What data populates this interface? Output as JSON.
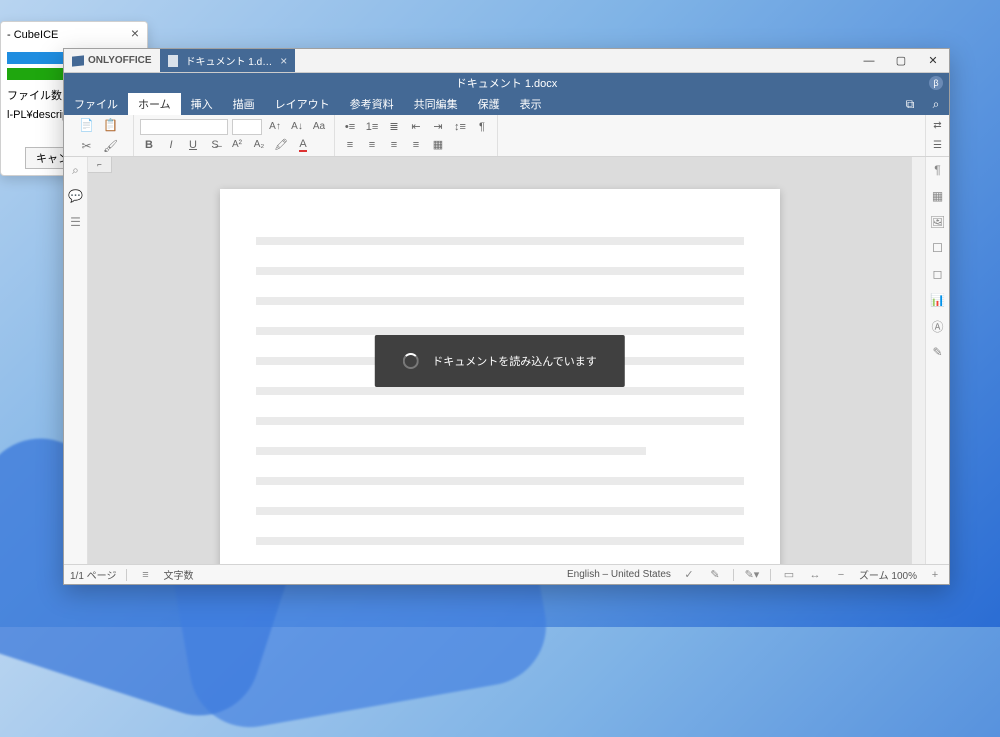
{
  "cubeice": {
    "title": " - CubeICE",
    "label1": "ファイル数",
    "label2": "l-PL¥description",
    "cancel": "キャン"
  },
  "onlyoffice": {
    "app_name": "ONLYOFFICE",
    "doctab_label": "ドキュメント 1.d…",
    "title": "ドキュメント 1.docx",
    "user_initial": "β",
    "menu": {
      "file": "ファイル",
      "home": "ホーム",
      "insert": "挿入",
      "draw": "描画",
      "layout": "レイアウト",
      "references": "参考資料",
      "collab": "共同編集",
      "protect": "保護",
      "view": "表示"
    },
    "loading": "ドキュメントを読み込んでいます",
    "status": {
      "page": "1/1 ページ",
      "wordcount": "文字数",
      "lang": "English – United States",
      "zoom": "ズーム 100%"
    }
  }
}
